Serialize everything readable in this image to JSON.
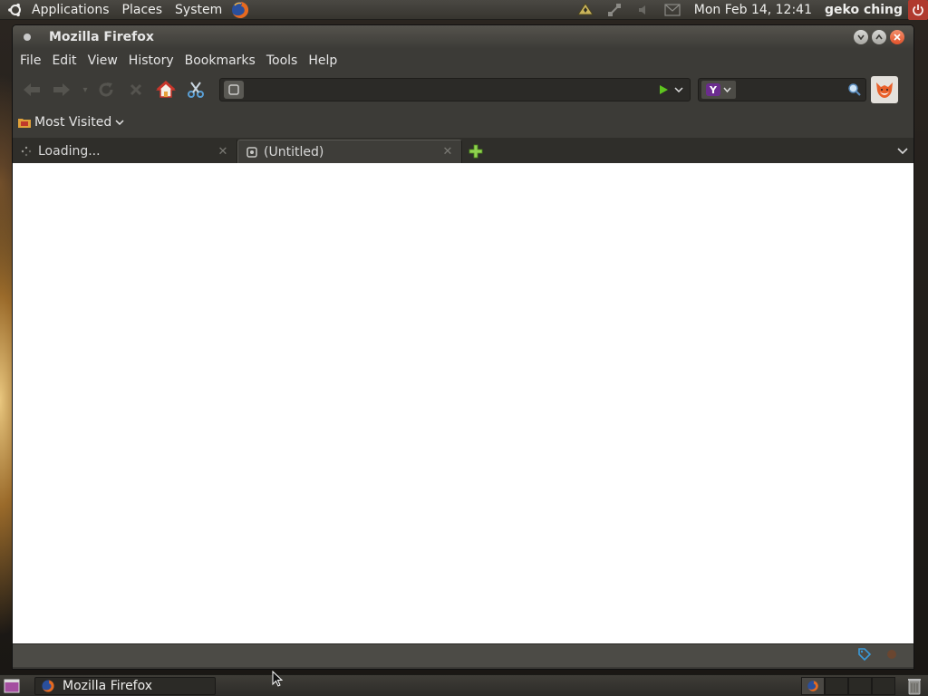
{
  "top_panel": {
    "menus": [
      "Applications",
      "Places",
      "System"
    ],
    "clock": "Mon Feb 14, 12:41",
    "user": "geko ching"
  },
  "window": {
    "title": "Mozilla Firefox",
    "menu": {
      "file": "File",
      "edit": "Edit",
      "view": "View",
      "history": "History",
      "bookmarks": "Bookmarks",
      "tools": "Tools",
      "help": "Help"
    },
    "url": {
      "value": ""
    },
    "search": {
      "value": ""
    },
    "bookmarks_bar": {
      "most_visited": "Most Visited"
    },
    "tabs": [
      {
        "label": "Loading...",
        "active": false
      },
      {
        "label": "(Untitled)",
        "active": true
      }
    ]
  },
  "taskbar": {
    "task_label": "Mozilla Firefox"
  },
  "colors": {
    "panel": "#3c3b37",
    "close_accent": "#e1532b",
    "power": "#b03a2e",
    "content": "#ffffff"
  }
}
